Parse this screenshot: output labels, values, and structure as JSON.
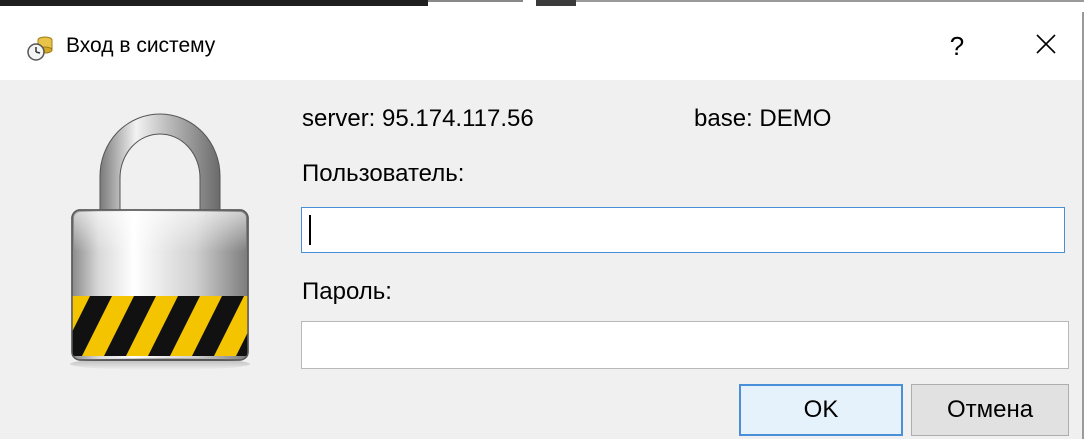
{
  "window": {
    "title": "Вход в систему",
    "help_label": "?",
    "icons": {
      "app": "database-clock-icon",
      "lock": "padlock-icon",
      "close": "close-icon"
    }
  },
  "info": {
    "server": "server: 95.174.117.56",
    "base": "base: DEMO"
  },
  "form": {
    "user_label": "Пользователь:",
    "user_value": "",
    "password_label": "Пароль:",
    "password_value": ""
  },
  "buttons": {
    "ok": "OK",
    "cancel": "Отмена"
  },
  "colors": {
    "accent": "#4a90d9",
    "stripe_yellow": "#f5c400",
    "stripe_black": "#111111"
  }
}
